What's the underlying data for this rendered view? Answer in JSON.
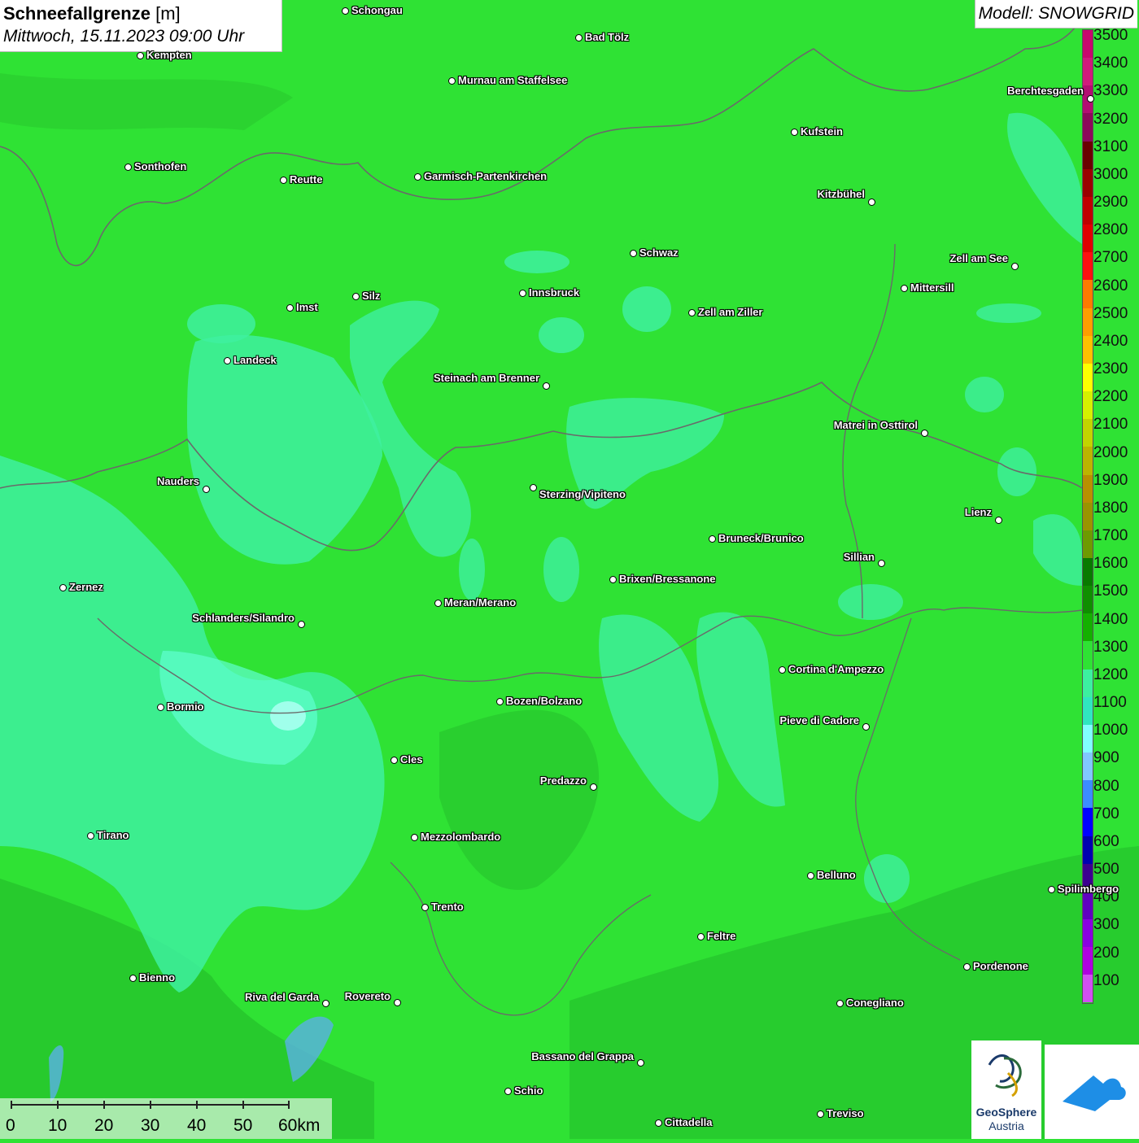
{
  "title": {
    "variable": "Schneefallgrenze",
    "unit": "[m]",
    "datetime": "Mittwoch, 15.11.2023 09:00 Uhr"
  },
  "model": "Modell: SNOWGRID",
  "legend": {
    "labels": [
      "3500",
      "3400",
      "3300",
      "3200",
      "3100",
      "3000",
      "2900",
      "2800",
      "2700",
      "2600",
      "2500",
      "2400",
      "2300",
      "2200",
      "2100",
      "2000",
      "1900",
      "1800",
      "1700",
      "1600",
      "1500",
      "1400",
      "1300",
      "1200",
      "1100",
      "1000",
      "900",
      "800",
      "700",
      "600",
      "500",
      "400",
      "300",
      "200",
      "100"
    ],
    "colors": [
      "#c8086e",
      "#d01a7c",
      "#b30e72",
      "#8c0a5a",
      "#6a0000",
      "#9a0000",
      "#c00000",
      "#e00000",
      "#ff1010",
      "#ff7a00",
      "#ff9e00",
      "#ffc000",
      "#ffff00",
      "#d6f000",
      "#c2d400",
      "#bcb400",
      "#b89000",
      "#9a9400",
      "#6e9a00",
      "#087a00",
      "#0f8e00",
      "#14b000",
      "#2fe234",
      "#3cf0a0",
      "#30e6c0",
      "#80ffff",
      "#80c8ff",
      "#3c8cff",
      "#0000ff",
      "#0000b0",
      "#3c0090",
      "#6000c0",
      "#8a00e0",
      "#b000e0",
      "#d050f0"
    ]
  },
  "cities": [
    {
      "name": "Schongau"
    },
    {
      "name": "Bad Tölz"
    },
    {
      "name": "Kempten"
    },
    {
      "name": "Murnau am Staffelsee"
    },
    {
      "name": "Berchtesgaden"
    },
    {
      "name": "Kufstein"
    },
    {
      "name": "Sonthofen"
    },
    {
      "name": "Reutte"
    },
    {
      "name": "Garmisch-Partenkirchen"
    },
    {
      "name": "Kitzbühel"
    },
    {
      "name": "Schwaz"
    },
    {
      "name": "Zell am See"
    },
    {
      "name": "Mittersill"
    },
    {
      "name": "Innsbruck"
    },
    {
      "name": "Imst"
    },
    {
      "name": "Silz"
    },
    {
      "name": "Zell am Ziller"
    },
    {
      "name": "Landeck"
    },
    {
      "name": "Steinach am Brenner"
    },
    {
      "name": "Matrei in Osttirol"
    },
    {
      "name": "Nauders"
    },
    {
      "name": "Sterzing/Vipiteno"
    },
    {
      "name": "Lienz"
    },
    {
      "name": "Bruneck/Brunico"
    },
    {
      "name": "Sillian"
    },
    {
      "name": "Zernez"
    },
    {
      "name": "Brixen/Bressanone"
    },
    {
      "name": "Meran/Merano"
    },
    {
      "name": "Schlanders/Silandro"
    },
    {
      "name": "Cortina d'Ampezzo"
    },
    {
      "name": "Bozen/Bolzano"
    },
    {
      "name": "Bormio"
    },
    {
      "name": "Pieve di Cadore"
    },
    {
      "name": "Cles"
    },
    {
      "name": "Predazzo"
    },
    {
      "name": "Tirano"
    },
    {
      "name": "Mezzolombardo"
    },
    {
      "name": "Belluno"
    },
    {
      "name": "Spilimbergo"
    },
    {
      "name": "Trento"
    },
    {
      "name": "Feltre"
    },
    {
      "name": "Pordenone"
    },
    {
      "name": "Bienno"
    },
    {
      "name": "Riva del Garda"
    },
    {
      "name": "Rovereto"
    },
    {
      "name": "Conegliano"
    },
    {
      "name": "Bassano del Grappa"
    },
    {
      "name": "Schio"
    },
    {
      "name": "Treviso"
    },
    {
      "name": "Cittadella"
    }
  ],
  "scale": {
    "labels": [
      "0",
      "10",
      "20",
      "30",
      "40",
      "50",
      "60km"
    ]
  },
  "logos": {
    "geosphere_line1": "GeoSphere",
    "geosphere_line2": "Austria"
  },
  "colors": {
    "map_base": "#2fe234",
    "map_dark": "#22b82a",
    "map_light": "#3ef0a0"
  }
}
